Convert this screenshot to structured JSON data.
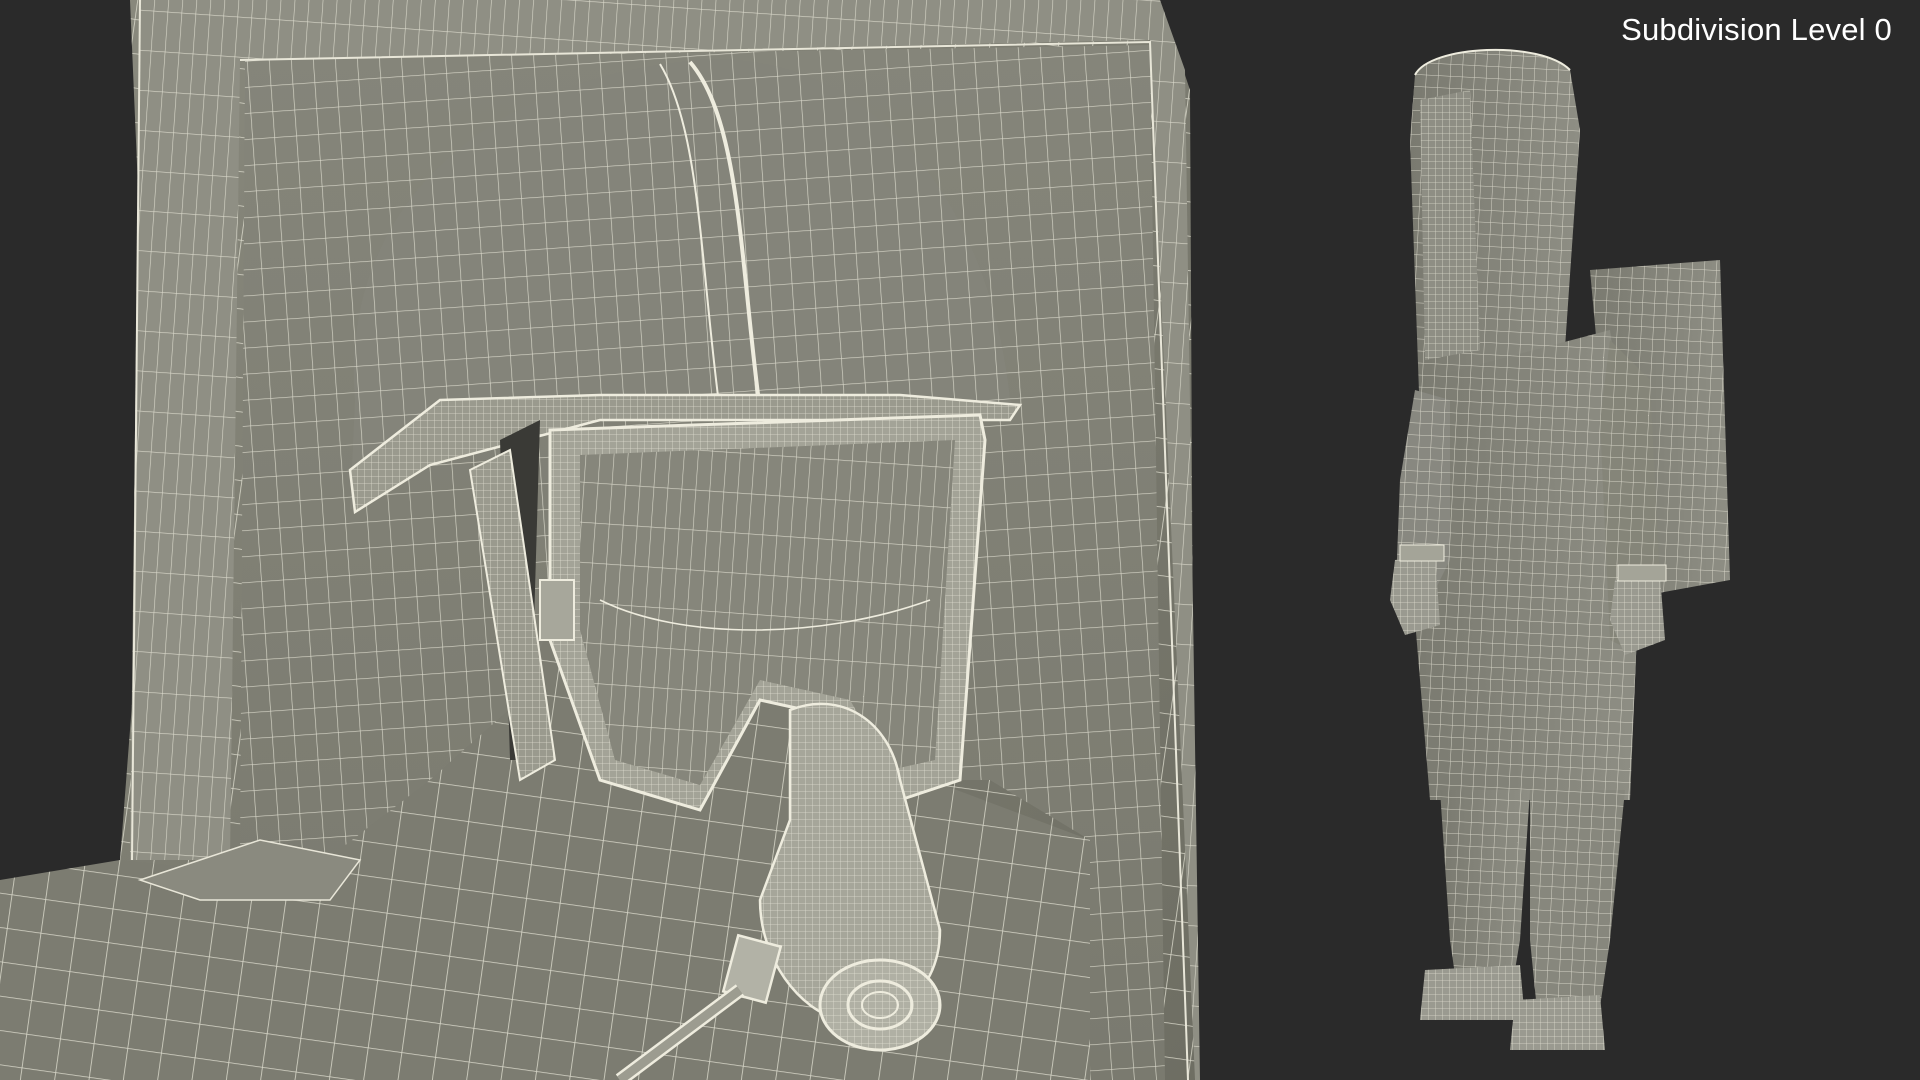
{
  "caption": {
    "text": "Subdivision Level 0"
  },
  "render": {
    "background_color": "#2a2a2a",
    "surface_color": "#7e7e72",
    "wire_color": "#e8e6d8"
  },
  "objects": {
    "closeup": "hazmat-suit-head-closeup-wireframe",
    "full_figure": "hazmat-suit-full-figure-wireframe"
  }
}
